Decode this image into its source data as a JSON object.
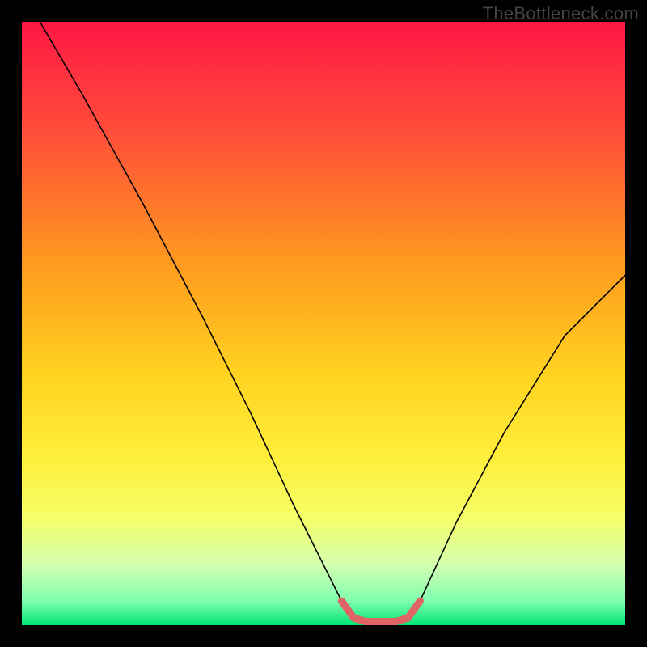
{
  "watermark": "TheBottleneck.com",
  "chart_data": {
    "type": "line",
    "title": "",
    "xlabel": "",
    "ylabel": "",
    "xlim": [
      0,
      100
    ],
    "ylim": [
      0,
      100
    ],
    "background_gradient": {
      "stops": [
        {
          "offset": 0,
          "color": "#ff1744"
        },
        {
          "offset": 18,
          "color": "#ff4d3a"
        },
        {
          "offset": 40,
          "color": "#ff9a1f"
        },
        {
          "offset": 58,
          "color": "#ffd21f"
        },
        {
          "offset": 72,
          "color": "#ffee3a"
        },
        {
          "offset": 82,
          "color": "#f6ff66"
        },
        {
          "offset": 90,
          "color": "#d4ffb0"
        },
        {
          "offset": 96,
          "color": "#7fffb0"
        },
        {
          "offset": 100,
          "color": "#00e676"
        }
      ]
    },
    "series": [
      {
        "name": "curve",
        "stroke": "#000000",
        "stroke_width": 1.6,
        "points_xy": [
          [
            3,
            100
          ],
          [
            10,
            88
          ],
          [
            20,
            70
          ],
          [
            30,
            51
          ],
          [
            38,
            35
          ],
          [
            45,
            20
          ],
          [
            50,
            10
          ],
          [
            53,
            4
          ],
          [
            55,
            1.2
          ],
          [
            57,
            0.6
          ],
          [
            62,
            0.6
          ],
          [
            64,
            1.2
          ],
          [
            66,
            4
          ],
          [
            72,
            17
          ],
          [
            80,
            32
          ],
          [
            90,
            48
          ],
          [
            100,
            58
          ]
        ]
      },
      {
        "name": "marker-trough",
        "stroke": "#e06464",
        "stroke_width": 9,
        "points_xy": [
          [
            53,
            4
          ],
          [
            55,
            1.2
          ],
          [
            57,
            0.6
          ],
          [
            62,
            0.6
          ],
          [
            64,
            1.2
          ],
          [
            66,
            4
          ]
        ]
      }
    ]
  }
}
